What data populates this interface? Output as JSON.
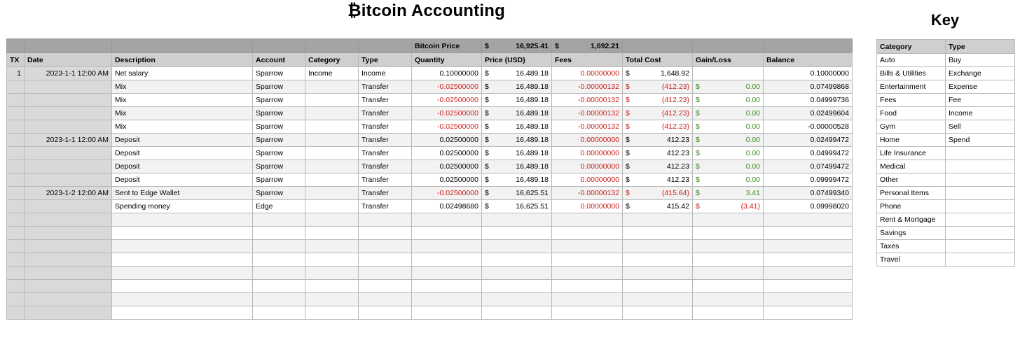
{
  "title": "₿itcoin Accounting",
  "key_title": "Key",
  "price_bar": {
    "label": "Bitcoin Price",
    "cur1": "$",
    "btc_price": "16,925.41",
    "cur2": "$",
    "value": "1,692.21"
  },
  "columns": [
    "TX",
    "Date",
    "Description",
    "Account",
    "Category",
    "Type",
    "Quantity",
    "Price (USD)",
    "Fees",
    "Total Cost",
    "Gain/Loss",
    "Balance"
  ],
  "rows": [
    {
      "tx": "1",
      "date": "2023-1-1 12:00 AM",
      "desc": "Net salary",
      "account": "Sparrow",
      "category": "Income",
      "type": "Income",
      "qty": "0.10000000",
      "qty_neg": false,
      "price": "16,489.18",
      "fees": "0.00000000",
      "fees_neg": true,
      "cost": "1,648.92",
      "cost_neg": false,
      "gain": "",
      "gain_cls": "",
      "balance": "0.10000000"
    },
    {
      "tx": "",
      "date": "",
      "desc": "Mix",
      "account": "Sparrow",
      "category": "",
      "type": "Transfer",
      "qty": "-0.02500000",
      "qty_neg": true,
      "price": "16,489.18",
      "fees": "-0.00000132",
      "fees_neg": true,
      "cost": "(412.23)",
      "cost_neg": true,
      "gain": "0.00",
      "gain_cls": "pos",
      "balance": "0.07499868"
    },
    {
      "tx": "",
      "date": "",
      "desc": "Mix",
      "account": "Sparrow",
      "category": "",
      "type": "Transfer",
      "qty": "-0.02500000",
      "qty_neg": true,
      "price": "16,489.18",
      "fees": "-0.00000132",
      "fees_neg": true,
      "cost": "(412.23)",
      "cost_neg": true,
      "gain": "0.00",
      "gain_cls": "pos",
      "balance": "0.04999736"
    },
    {
      "tx": "",
      "date": "",
      "desc": "Mix",
      "account": "Sparrow",
      "category": "",
      "type": "Transfer",
      "qty": "-0.02500000",
      "qty_neg": true,
      "price": "16,489.18",
      "fees": "-0.00000132",
      "fees_neg": true,
      "cost": "(412.23)",
      "cost_neg": true,
      "gain": "0.00",
      "gain_cls": "pos",
      "balance": "0.02499604"
    },
    {
      "tx": "",
      "date": "",
      "desc": "Mix",
      "account": "Sparrow",
      "category": "",
      "type": "Transfer",
      "qty": "-0.02500000",
      "qty_neg": true,
      "price": "16,489.18",
      "fees": "-0.00000132",
      "fees_neg": true,
      "cost": "(412.23)",
      "cost_neg": true,
      "gain": "0.00",
      "gain_cls": "pos",
      "balance": "-0.00000528"
    },
    {
      "tx": "",
      "date": "2023-1-1 12:00 AM",
      "desc": "Deposit",
      "account": "Sparrow",
      "category": "",
      "type": "Transfer",
      "qty": "0.02500000",
      "qty_neg": false,
      "price": "16,489.18",
      "fees": "0.00000000",
      "fees_neg": true,
      "cost": "412.23",
      "cost_neg": false,
      "gain": "0.00",
      "gain_cls": "pos",
      "balance": "0.02499472"
    },
    {
      "tx": "",
      "date": "",
      "desc": "Deposit",
      "account": "Sparrow",
      "category": "",
      "type": "Transfer",
      "qty": "0.02500000",
      "qty_neg": false,
      "price": "16,489.18",
      "fees": "0.00000000",
      "fees_neg": true,
      "cost": "412.23",
      "cost_neg": false,
      "gain": "0.00",
      "gain_cls": "pos",
      "balance": "0.04999472"
    },
    {
      "tx": "",
      "date": "",
      "desc": "Deposit",
      "account": "Sparrow",
      "category": "",
      "type": "Transfer",
      "qty": "0.02500000",
      "qty_neg": false,
      "price": "16,489.18",
      "fees": "0.00000000",
      "fees_neg": true,
      "cost": "412.23",
      "cost_neg": false,
      "gain": "0.00",
      "gain_cls": "pos",
      "balance": "0.07499472"
    },
    {
      "tx": "",
      "date": "",
      "desc": "Deposit",
      "account": "Sparrow",
      "category": "",
      "type": "Transfer",
      "qty": "0.02500000",
      "qty_neg": false,
      "price": "16,489.18",
      "fees": "0.00000000",
      "fees_neg": true,
      "cost": "412.23",
      "cost_neg": false,
      "gain": "0.00",
      "gain_cls": "pos",
      "balance": "0.09999472"
    },
    {
      "tx": "",
      "date": "2023-1-2 12:00 AM",
      "desc": "Sent to Edge Wallet",
      "account": "Sparrow",
      "category": "",
      "type": "Transfer",
      "qty": "-0.02500000",
      "qty_neg": true,
      "price": "16,625.51",
      "fees": "-0.00000132",
      "fees_neg": true,
      "cost": "(415.64)",
      "cost_neg": true,
      "gain": "3.41",
      "gain_cls": "pos",
      "balance": "0.07499340"
    },
    {
      "tx": "",
      "date": "",
      "desc": "Spending money",
      "account": "Edge",
      "category": "",
      "type": "Transfer",
      "qty": "0.02498680",
      "qty_neg": false,
      "price": "16,625.51",
      "fees": "0.00000000",
      "fees_neg": true,
      "cost": "415.42",
      "cost_neg": false,
      "gain": "(3.41)",
      "gain_cls": "neg",
      "balance": "0.09998020"
    }
  ],
  "empty_rows": 8,
  "currency_symbol": "$",
  "key": {
    "headers": [
      "Category",
      "Type"
    ],
    "categories": [
      "Auto",
      "Bills & Utilities",
      "Entertainment",
      "Fees",
      "Food",
      "Gym",
      "Home",
      "Life Insurance",
      "Medical",
      "Other",
      "Personal Items",
      "Phone",
      "Rent & Mortgage",
      "Savings",
      "Taxes",
      "Travel"
    ],
    "types": [
      "Buy",
      "Exchange",
      "Expense",
      "Fee",
      "Income",
      "Sell",
      "Spend"
    ]
  },
  "colors": {
    "negative": "#d0201c",
    "positive": "#3e8e1f",
    "header_bg": "#cfcfcf",
    "price_bar_bg": "#a4a4a4"
  }
}
